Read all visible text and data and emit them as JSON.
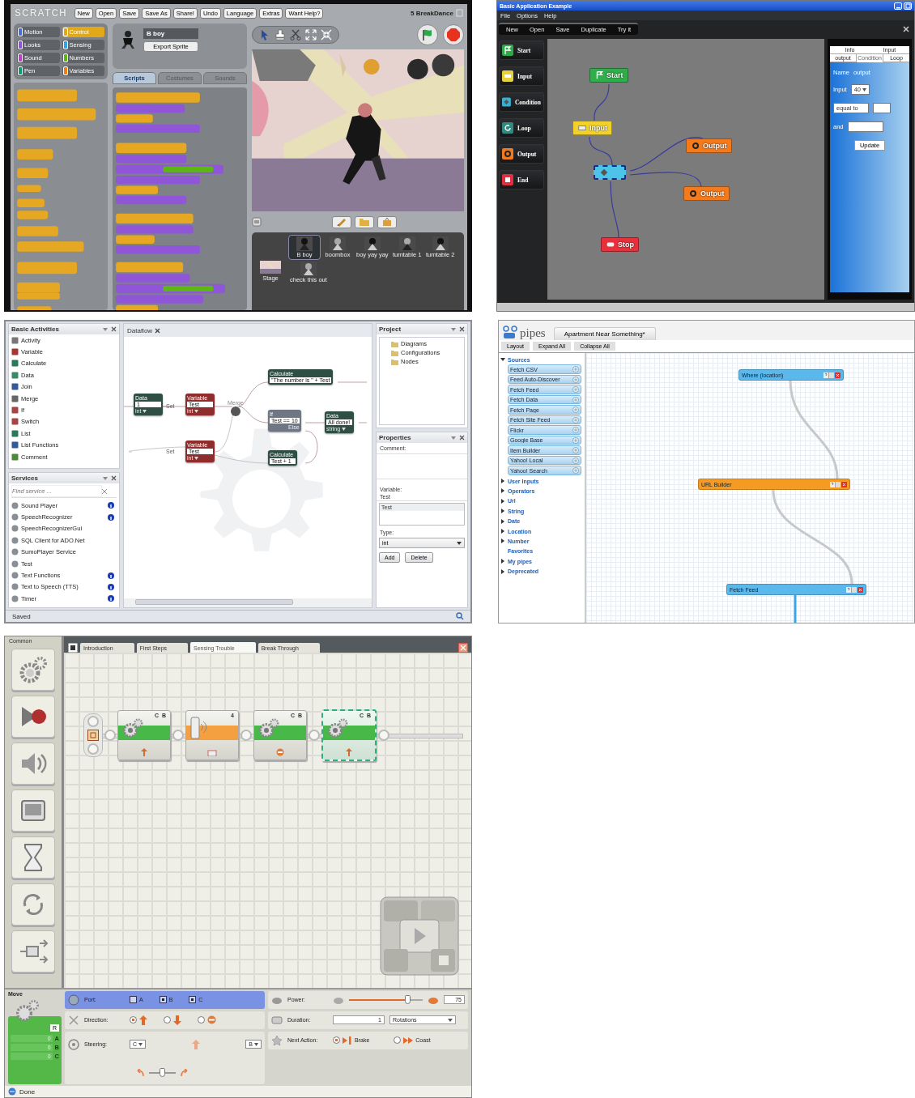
{
  "scratch": {
    "logo": "SCRATCH",
    "menu": [
      "New",
      "Open",
      "Save",
      "Save As",
      "Share!",
      "Undo",
      "Language",
      "Extras",
      "Want Help?"
    ],
    "project_title": "5 BreakDance",
    "categories": [
      {
        "label": "Motion",
        "color": "#4a6cd4",
        "selected": false
      },
      {
        "label": "Control",
        "color": "#e1a91a",
        "selected": true
      },
      {
        "label": "Looks",
        "color": "#8a55d7",
        "selected": false
      },
      {
        "label": "Sensing",
        "color": "#2ca5e2",
        "selected": false
      },
      {
        "label": "Sound",
        "color": "#bb42c3",
        "selected": false
      },
      {
        "label": "Numbers",
        "color": "#5cb712",
        "selected": false
      },
      {
        "label": "Pen",
        "color": "#0e9a6c",
        "selected": false
      },
      {
        "label": "Variables",
        "color": "#ee7d16",
        "selected": false
      }
    ],
    "sprite_name": "B boy",
    "export_button": "Export Sprite",
    "tabs": [
      {
        "label": "Scripts",
        "selected": true
      },
      {
        "label": "Costumes",
        "selected": false
      },
      {
        "label": "Sounds",
        "selected": false
      }
    ],
    "sprites": [
      {
        "name": "B boy",
        "selected": true
      },
      {
        "name": "boombox",
        "selected": false
      },
      {
        "name": "boy yay yay",
        "selected": false
      },
      {
        "name": "turntable 1",
        "selected": false
      },
      {
        "name": "turntable 2",
        "selected": false
      },
      {
        "name": "check this out",
        "selected": false
      }
    ],
    "stage_label": "Stage"
  },
  "flow": {
    "title": "Basic Application Example",
    "menu": [
      "File",
      "Options",
      "Help"
    ],
    "toolbar": [
      "New",
      "Open",
      "Save",
      "Duplicate",
      "Try it"
    ],
    "palette": [
      {
        "label": "Start",
        "kind": "start",
        "color": "#2fa84a"
      },
      {
        "label": "Input",
        "kind": "input",
        "color": "#e8d23a"
      },
      {
        "label": "Condition",
        "kind": "condition",
        "color": "#3ab0d0"
      },
      {
        "label": "Loop",
        "kind": "loop",
        "color": "#2f8a80"
      },
      {
        "label": "Output",
        "kind": "output",
        "color": "#f07a20"
      },
      {
        "label": "End",
        "kind": "end",
        "color": "#e03040"
      }
    ],
    "nodes": [
      {
        "label": "Start",
        "kind": "start",
        "color": "#2fae4a",
        "selected": false
      },
      {
        "label": "Input",
        "kind": "input",
        "color": "#f2d22a",
        "selected": false
      },
      {
        "kind": "condition",
        "color": "#4cc4e8",
        "selected": true
      },
      {
        "label": "Output",
        "kind": "output",
        "color": "#f57a1c",
        "selected": false
      },
      {
        "label": "Output",
        "kind": "output",
        "color": "#f57a1c",
        "selected": false
      },
      {
        "label": "Stop",
        "kind": "end",
        "color": "#e8303c",
        "selected": false
      }
    ],
    "tabs_top": [
      "Info",
      "Input"
    ],
    "tabs": [
      {
        "label": "output",
        "selected": false
      },
      {
        "label": "Condition",
        "selected": true
      },
      {
        "label": "Loop",
        "selected": false
      }
    ],
    "name_label": "Name",
    "name_value": "output",
    "input_label": "Input",
    "input_value": "40",
    "operator": "equal to",
    "and_label": "and",
    "update_button": "Update"
  },
  "dataflow": {
    "activities": {
      "title": "Basic Activities",
      "items": [
        "Activity",
        "Variable",
        "Calculate",
        "Data",
        "Join",
        "Merge",
        "If",
        "Switch",
        "List",
        "List Functions",
        "Comment"
      ]
    },
    "services": {
      "title": "Services",
      "placeholder": "Find service ...",
      "items": [
        {
          "label": "Sound Player",
          "info": true
        },
        {
          "label": "SpeechRecognizer",
          "info": true
        },
        {
          "label": "SpeechRecognizerGui",
          "info": false
        },
        {
          "label": "SQL Client for ADO.Net",
          "info": false
        },
        {
          "label": "SumoPlayer Service",
          "info": false
        },
        {
          "label": "Test",
          "info": false
        },
        {
          "label": "Text Functions",
          "info": true
        },
        {
          "label": "Text to Speech (TTS)",
          "info": true
        },
        {
          "label": "Timer",
          "info": true
        }
      ]
    },
    "tab": "Dataflow",
    "nodes": [
      {
        "kind": "data",
        "title": "Data",
        "value": "1",
        "type": "int"
      },
      {
        "kind": "variable",
        "title": "Variable",
        "value": "Test",
        "type": "int"
      },
      {
        "kind": "merge",
        "title": "Merge"
      },
      {
        "kind": "calculate",
        "title": "Calculate",
        "value": "\"The number is \" + Test"
      },
      {
        "kind": "if",
        "title": "If",
        "value": "Test == 10",
        "else": "Else"
      },
      {
        "kind": "data",
        "title": "Data",
        "value": "All done!",
        "type": "string"
      },
      {
        "kind": "variable",
        "title": "Variable",
        "value": "Test",
        "type": "int"
      },
      {
        "kind": "calculate",
        "title": "Calculate",
        "value": "Test + 1"
      }
    ],
    "set_labels": [
      "Set",
      "Set"
    ],
    "project": {
      "title": "Project",
      "items": [
        "Diagrams",
        "Configurations",
        "Nodes"
      ]
    },
    "properties": {
      "title": "Properties",
      "comment_label": "Comment:",
      "variable_label": "Variable:",
      "variable_name": "Test",
      "variable_value": "Test",
      "type_label": "Type:",
      "type_value": "int",
      "buttons": [
        "Add",
        "Delete"
      ]
    },
    "status": "Saved"
  },
  "pipes": {
    "logo": "pipes",
    "tab": "Apartment Near Something*",
    "toolbar": [
      "Layout",
      "Expand All",
      "Collapse All"
    ],
    "library": [
      {
        "label": "Sources",
        "expandable": true,
        "expanded": true,
        "children": [
          {
            "label": "Fetch CSV"
          },
          {
            "label": "Feed Auto-Discover"
          },
          {
            "label": "Fetch Feed"
          },
          {
            "label": "Fetch Data"
          },
          {
            "label": "Fetch Page"
          },
          {
            "label": "Fetch Site Feed"
          },
          {
            "label": "Flickr"
          },
          {
            "label": "Google Base"
          },
          {
            "label": "Item Builder"
          },
          {
            "label": "Yahoo! Local"
          },
          {
            "label": "Yahoo! Search"
          }
        ]
      },
      {
        "label": "User Inputs",
        "expandable": true,
        "expanded": false
      },
      {
        "label": "Operators",
        "expandable": true,
        "expanded": false
      },
      {
        "label": "Url",
        "expandable": true,
        "expanded": false
      },
      {
        "label": "String",
        "expandable": true,
        "expanded": false
      },
      {
        "label": "Date",
        "expandable": true,
        "expanded": false
      },
      {
        "label": "Location",
        "expandable": true,
        "expanded": false
      },
      {
        "label": "Number",
        "expandable": true,
        "expanded": false
      },
      {
        "label": "Favorites",
        "expandable": false,
        "expanded": false
      },
      {
        "label": "My pipes",
        "expandable": true,
        "expanded": false
      },
      {
        "label": "Deprecated",
        "expandable": true,
        "expanded": false
      }
    ],
    "modules": [
      {
        "label": "Where (location)",
        "color": "#5ab8ec"
      },
      {
        "label": "URL Builder",
        "color": "#f59a22"
      },
      {
        "label": "Fetch Feed",
        "color": "#5ab8ec"
      }
    ]
  },
  "nxt": {
    "palette_title": "Common",
    "tabs": [
      {
        "label": "Introduction",
        "selected": false
      },
      {
        "label": "First Steps",
        "selected": false
      },
      {
        "label": "Sensing Trouble",
        "selected": true
      },
      {
        "label": "Break Through",
        "selected": false
      }
    ],
    "blocks": [
      {
        "kind": "move",
        "ports": "C B",
        "stopped": false,
        "selected": false
      },
      {
        "kind": "sensor",
        "port": "4",
        "selected": false
      },
      {
        "kind": "move",
        "ports": "C B",
        "stopped": true,
        "selected": false
      },
      {
        "kind": "move",
        "ports": "C B",
        "stopped": false,
        "selected": true
      }
    ],
    "config": {
      "title": "Move",
      "r_label": "R",
      "readings": [
        {
          "value": "0",
          "port": "A"
        },
        {
          "value": "0",
          "port": "B"
        },
        {
          "value": "0",
          "port": "C"
        }
      ],
      "port_label": "Port:",
      "ports": [
        {
          "label": "A",
          "checked": false
        },
        {
          "label": "B",
          "checked": true
        },
        {
          "label": "C",
          "checked": true
        }
      ],
      "direction_label": "Direction:",
      "directions": [
        {
          "kind": "forward",
          "selected": true
        },
        {
          "kind": "backward",
          "selected": false
        },
        {
          "kind": "stop",
          "selected": false
        }
      ],
      "steering_label": "Steering:",
      "steering": {
        "left": "C",
        "right": "B",
        "level": 0.5
      },
      "power": {
        "label": "Power:",
        "level": 0.8,
        "value": "75"
      },
      "duration": {
        "label": "Duration:",
        "value": "1",
        "unit": "Rotations"
      },
      "next_action": {
        "label": "Next Action:",
        "options": [
          {
            "label": "Brake",
            "selected": true
          },
          {
            "label": "Coast",
            "selected": false
          }
        ]
      }
    },
    "status": "Done"
  }
}
